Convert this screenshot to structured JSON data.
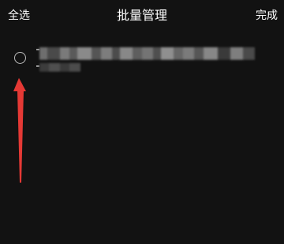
{
  "nav": {
    "select_all": "全选",
    "title": "批量管理",
    "done": "完成"
  },
  "list": {
    "items": [
      {
        "selected": false
      }
    ]
  },
  "colors": {
    "background": "#121212",
    "text": "#ffffff",
    "radio_border": "#bdbdbd",
    "annotation_arrow": "#e53935"
  },
  "icons": {
    "radio": "empty-circle",
    "annotation": "red-arrow-up"
  }
}
